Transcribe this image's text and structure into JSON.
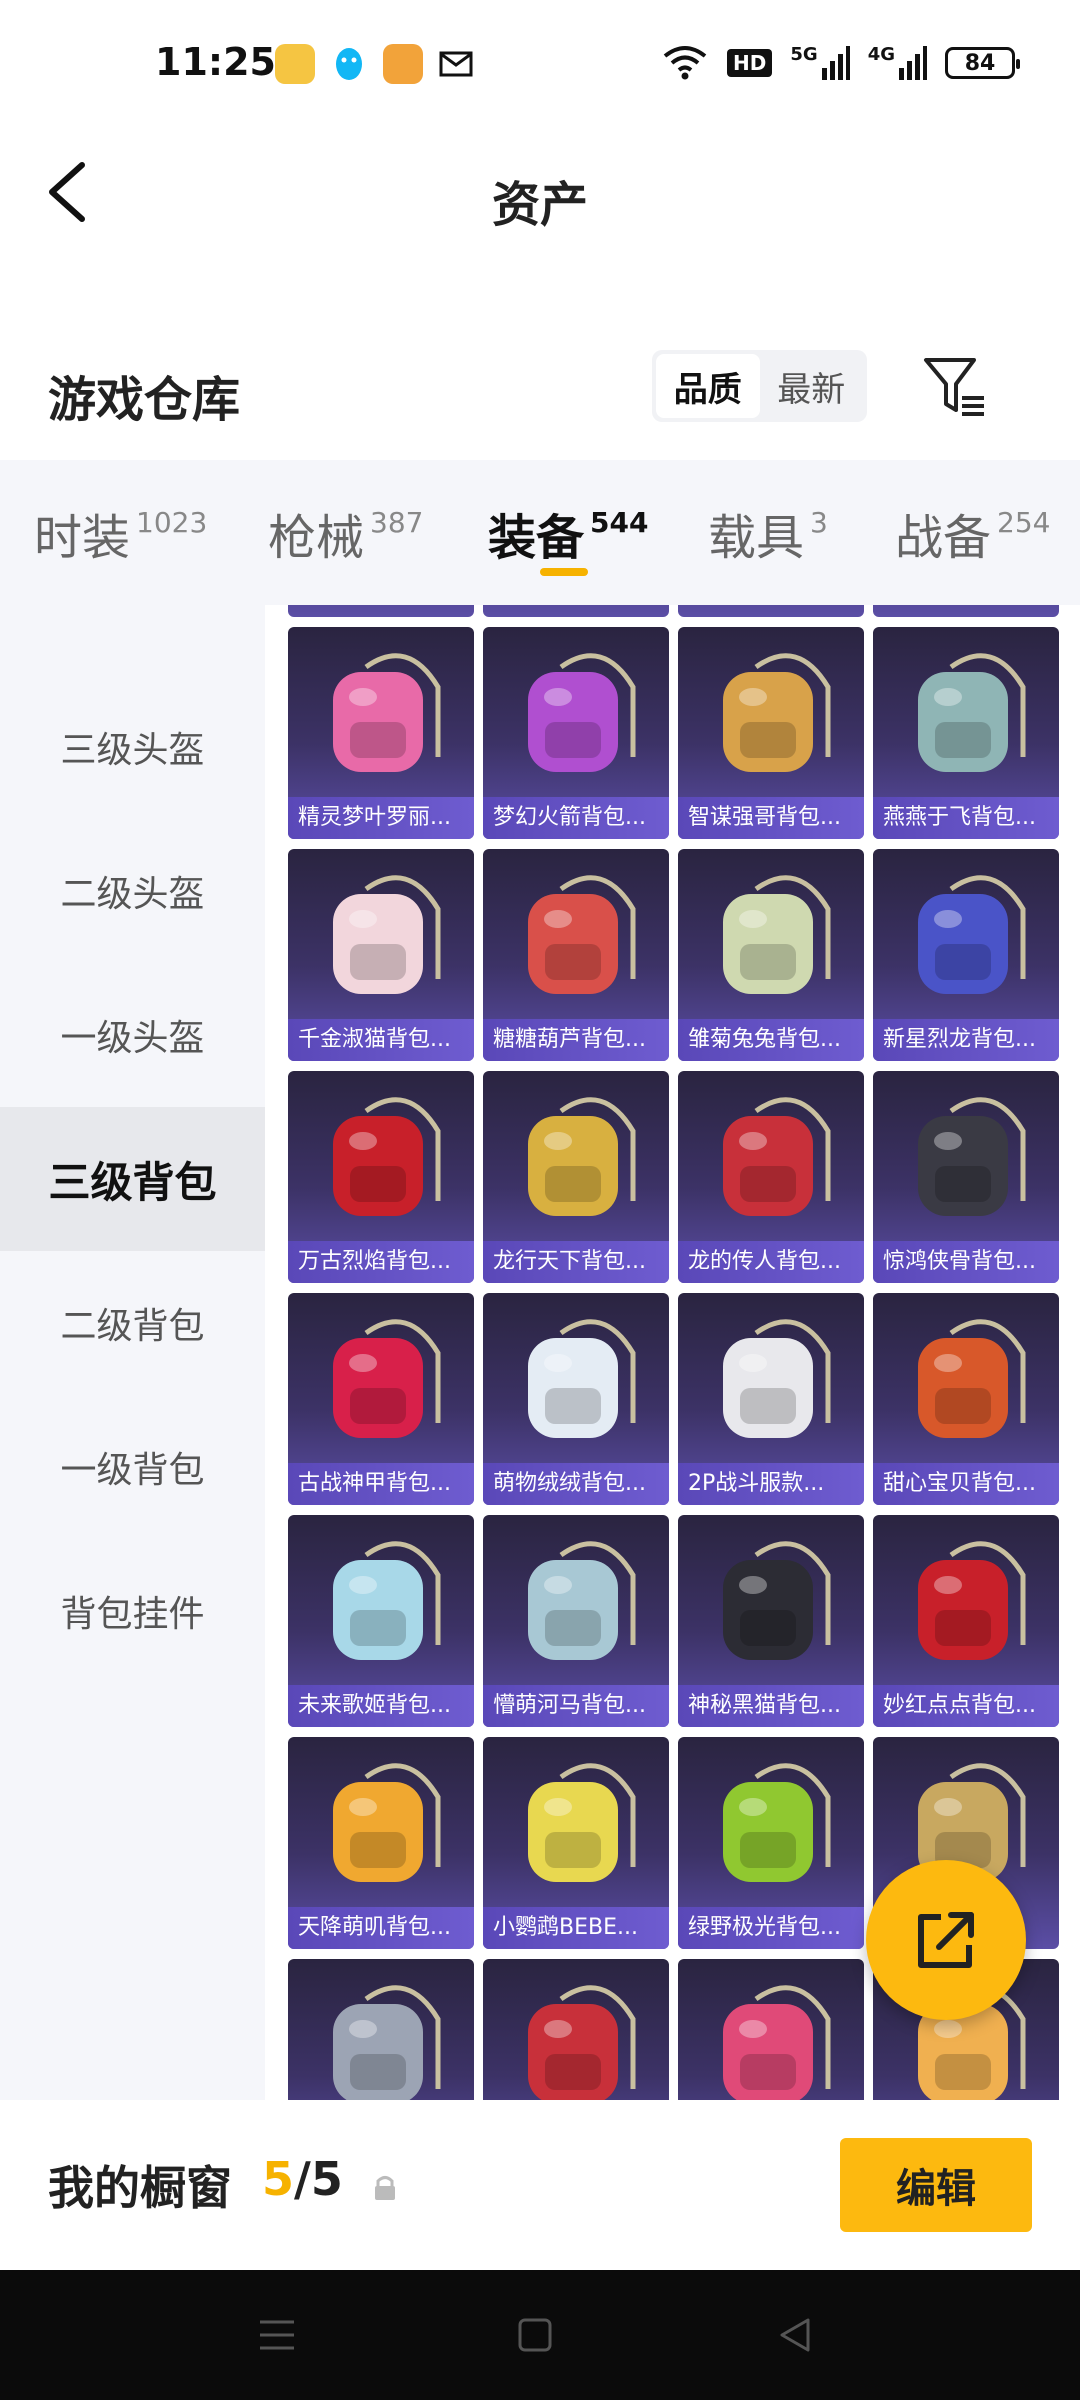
{
  "status": {
    "time": "11:25",
    "battery": "84",
    "net1": "HD",
    "net2": "5G",
    "net3": "4G"
  },
  "header": {
    "title": "资产"
  },
  "section": {
    "title": "游戏仓库",
    "sort": [
      "品质",
      "最新"
    ]
  },
  "tabs": [
    {
      "label": "时装",
      "count": "1023"
    },
    {
      "label": "枪械",
      "count": "387"
    },
    {
      "label": "装备",
      "count": "544",
      "active": true
    },
    {
      "label": "载具",
      "count": "3"
    },
    {
      "label": "战备",
      "count": "254"
    }
  ],
  "sidebar": [
    {
      "label": "三级头盔"
    },
    {
      "label": "二级头盔"
    },
    {
      "label": "一级头盔"
    },
    {
      "label": "三级背包",
      "active": true
    },
    {
      "label": "二级背包"
    },
    {
      "label": "一级背包"
    },
    {
      "label": "背包挂件"
    }
  ],
  "items": [
    {
      "name": "精灵梦叶罗丽...",
      "color": "#e86aa8"
    },
    {
      "name": "梦幻火箭背包...",
      "color": "#b04fd0"
    },
    {
      "name": "智谋强哥背包...",
      "color": "#d8a24a"
    },
    {
      "name": "燕燕于飞背包...",
      "color": "#8fb5b5"
    },
    {
      "name": "千金淑猫背包...",
      "color": "#f2d6dc"
    },
    {
      "name": "糖糖葫芦背包...",
      "color": "#d9504a"
    },
    {
      "name": "雏菊兔兔背包...",
      "color": "#cfd9b0"
    },
    {
      "name": "新星烈龙背包...",
      "color": "#4a54c8"
    },
    {
      "name": "万古烈焰背包...",
      "color": "#c8202a"
    },
    {
      "name": "龙行天下背包...",
      "color": "#d8b040"
    },
    {
      "name": "龙的传人背包...",
      "color": "#c8303a"
    },
    {
      "name": "惊鸿侠骨背包...",
      "color": "#3a3a44"
    },
    {
      "name": "古战神甲背包...",
      "color": "#d8204a"
    },
    {
      "name": "萌物绒绒背包...",
      "color": "#e4ecf4"
    },
    {
      "name": "2P战斗服款...",
      "color": "#e8e8ec"
    },
    {
      "name": "甜心宝贝背包...",
      "color": "#d8582a"
    },
    {
      "name": "未来歌姬背包...",
      "color": "#a8d8e8"
    },
    {
      "name": "懵萌河马背包...",
      "color": "#a8c8d4"
    },
    {
      "name": "神秘黑猫背包...",
      "color": "#2c2c34"
    },
    {
      "name": "妙红点点背包...",
      "color": "#c8202a"
    },
    {
      "name": "天降萌叽背包...",
      "color": "#f0a830"
    },
    {
      "name": "小鹦鹉BEBE...",
      "color": "#e8d850"
    },
    {
      "name": "绿野极光背包...",
      "color": "#90c830"
    },
    {
      "name": "",
      "color": "#c8a860"
    },
    {
      "name": "",
      "color": "#9ca4b4"
    },
    {
      "name": "",
      "color": "#c8303a"
    },
    {
      "name": "",
      "color": "#e04a78"
    },
    {
      "name": "",
      "color": "#f0b050"
    }
  ],
  "bottom": {
    "label": "我的橱窗",
    "current": "5",
    "sep": "/",
    "total": "5",
    "edit": "编辑"
  }
}
